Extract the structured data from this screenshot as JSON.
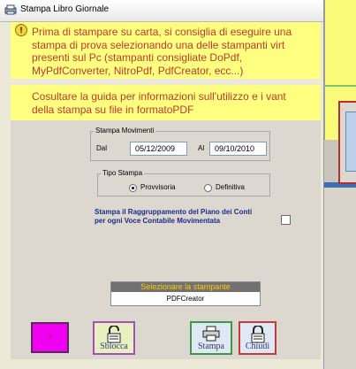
{
  "window": {
    "title": "Stampa Libro Giornale"
  },
  "note1": {
    "lines": [
      "Prima di stampare su carta, si consiglia di eseguire una",
      "stampa di prova selezionando una delle stampanti virt",
      "presenti sul Pc (stampanti consigliate DoPdf,",
      "MyPdfConverter, NitroPdf, PdfCreator, ecc...)"
    ]
  },
  "note2": {
    "lines": [
      "Cosultare la guida per  informazioni sull'utilizzo e i vant",
      "della stampa su file in formatoPDF"
    ]
  },
  "movimenti": {
    "legend": "Stampa Movimenti",
    "dal_label": "Dal",
    "dal_value": "05/12/2009",
    "al_label": "Al",
    "al_value": "09/10/2010"
  },
  "tipo": {
    "legend": "Tipo Stampa",
    "provvisoria": "Provvisoria",
    "definitiva": "Definitiva",
    "selected": "Provvisoria"
  },
  "raggruppamento": {
    "line1": "Stampa il Raggruppamento del Piano dei Conti",
    "line2": "per ogni Voce Contabile Movimentata",
    "checked": false
  },
  "printer": {
    "header": "Selezionare la stampante",
    "value": "PDFCreator"
  },
  "buttons": {
    "help": "?",
    "sblocca": "Sblocca",
    "stampa": "Stampa",
    "chiudi": "Chiudi"
  },
  "colors": {
    "note_bg": "#ffff80",
    "note_text": "#c0392b",
    "help_bg": "#f000f0",
    "printer_header_text": "#ffcc00"
  }
}
